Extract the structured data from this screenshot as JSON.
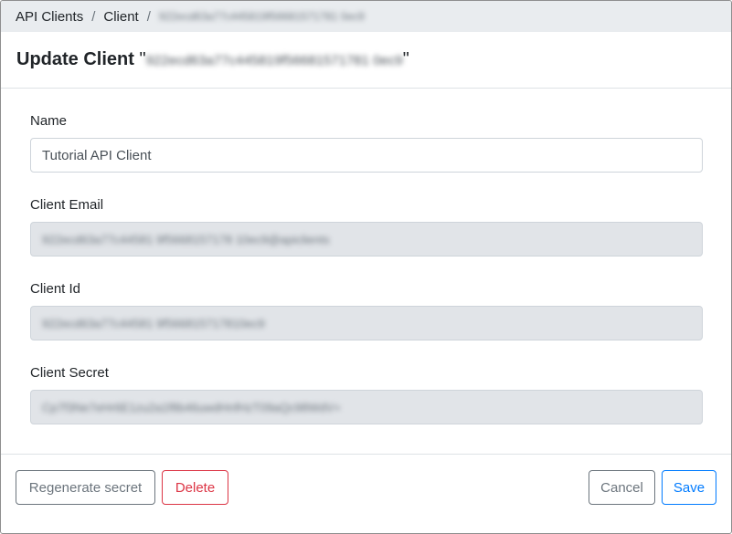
{
  "breadcrumb": {
    "items": [
      "API Clients",
      "Client"
    ],
    "separator": "/",
    "current": "922ecd63a77c445819f56681571781 0ec9"
  },
  "header": {
    "title_prefix": "Update Client",
    "quote_open": "\"",
    "client_name": "922ecd63a77c445819f56681571781 0ec9",
    "quote_close": "\""
  },
  "form": {
    "name": {
      "label": "Name",
      "value": "Tutorial API Client"
    },
    "client_email": {
      "label": "Client Email",
      "value": "922ecd63a77c44581 9f5668157178 10ec9@apiclients"
    },
    "client_id": {
      "label": "Client Id",
      "value": "922ecd63a77c44581 9f566815717810ec9"
    },
    "client_secret": {
      "label": "Client Secret",
      "value": "Cp7f3Ne7eHr6E1zu2a1f8b46uwdHnfHzT09aQc98WdV+"
    }
  },
  "footer": {
    "regenerate_label": "Regenerate secret",
    "delete_label": "Delete",
    "cancel_label": "Cancel",
    "save_label": "Save"
  },
  "colors": {
    "breadcrumb_bg": "#e9ecef",
    "readonly_bg": "#e1e4e8",
    "danger": "#dc3545",
    "primary": "#007bff",
    "secondary": "#6c757d"
  }
}
